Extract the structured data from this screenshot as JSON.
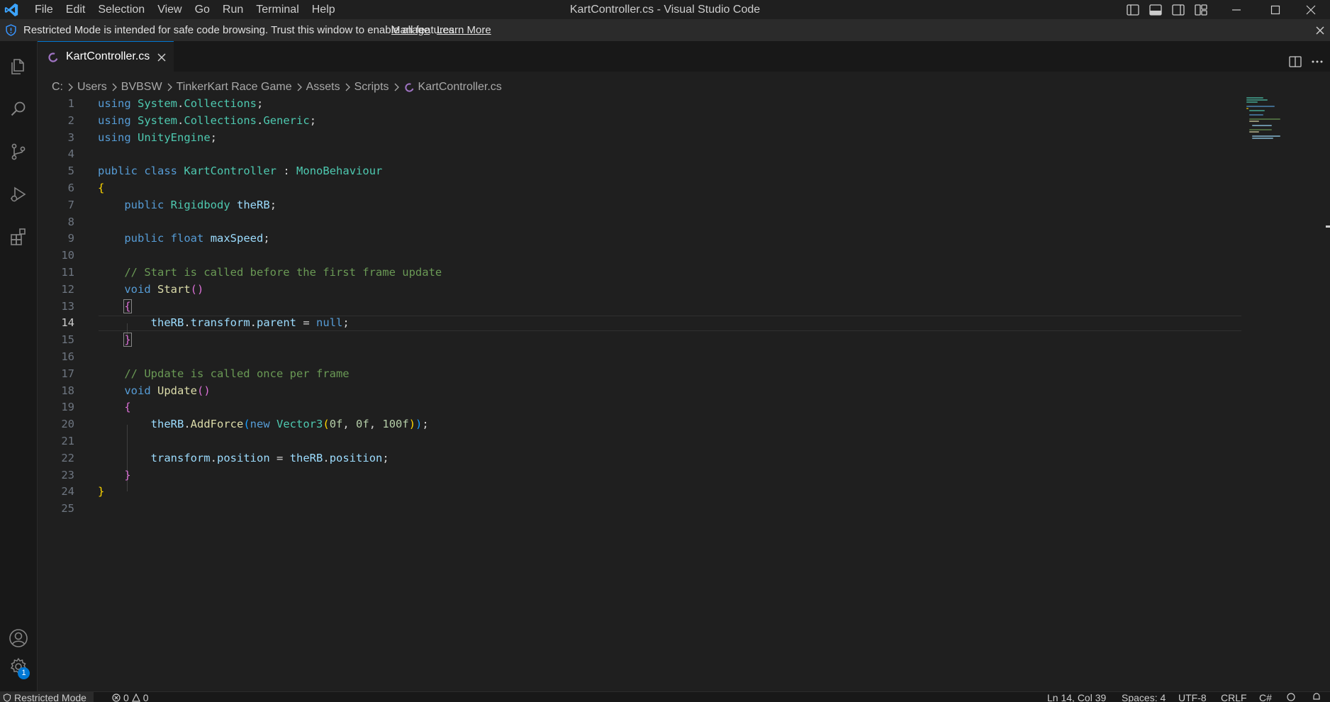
{
  "app": {
    "window_title": "KartController.cs - Visual Studio Code",
    "menu": [
      "File",
      "Edit",
      "Selection",
      "View",
      "Go",
      "Run",
      "Terminal",
      "Help"
    ]
  },
  "banner": {
    "text": "Restricted Mode is intended for safe code browsing. Trust this window to enable all features.",
    "manage_link": "Manage",
    "learn_more_link": "Learn More"
  },
  "activity_bar": {
    "icons": [
      "explorer-icon",
      "search-icon",
      "source-control-icon",
      "run-debug-icon",
      "extensions-icon",
      "accounts-icon",
      "manage-gear-icon"
    ],
    "settings_badge": "1"
  },
  "tab": {
    "label": "KartController.cs",
    "icon": "csharp-file-icon"
  },
  "breadcrumbs": [
    "C:",
    "Users",
    "BVBSW",
    "TinkerKart Race Game",
    "Assets",
    "Scripts",
    "KartController.cs"
  ],
  "editor": {
    "active_line": 14,
    "line_numbers": [
      "1",
      "2",
      "3",
      "4",
      "5",
      "6",
      "7",
      "8",
      "9",
      "10",
      "11",
      "12",
      "13",
      "14",
      "15",
      "16",
      "17",
      "18",
      "19",
      "20",
      "21",
      "22",
      "23",
      "24",
      "25"
    ],
    "code": {
      "l1": {
        "kw": "using",
        "ns1": "System",
        "dot": ".",
        "ns2": "Collections",
        "semi": ";"
      },
      "l2": {
        "kw": "using",
        "ns1": "System",
        "ns2": "Collections",
        "ns3": "Generic"
      },
      "l3": {
        "kw": "using",
        "ns1": "UnityEngine"
      },
      "l5": {
        "kw1": "public",
        "kw2": "class",
        "name": "KartController",
        "colon": ":",
        "base": "MonoBehaviour"
      },
      "l7": {
        "kw": "public",
        "type": "Rigidbody",
        "field": "theRB"
      },
      "l9": {
        "kw1": "public",
        "kw2": "float",
        "field": "maxSpeed"
      },
      "l11": "// Start is called before the first frame update",
      "l12": {
        "kw": "void",
        "fn": "Start",
        "paren": "()"
      },
      "l14": {
        "obj": "theRB",
        "p1": "transform",
        "p2": "parent",
        "eq": "=",
        "null": "null"
      },
      "l17": "// Update is called once per frame",
      "l18": {
        "kw": "void",
        "fn": "Update",
        "paren": "()"
      },
      "l20": {
        "obj": "theRB",
        "fn": "AddForce",
        "kw": "new",
        "type": "Vector3",
        "a1": "0f",
        "a2": "0f",
        "a3": "100f"
      },
      "l22": {
        "obj": "transform",
        "p1": "position",
        "eq": "=",
        "obj2": "theRB",
        "p2": "position"
      },
      "open_brace": "{",
      "close_brace": "}"
    }
  },
  "status_bar": {
    "restricted_mode": "Restricted Mode",
    "errors": "0",
    "warnings": "0",
    "cursor_position": "Ln 14, Col 39",
    "indentation": "Spaces: 4",
    "encoding": "UTF-8",
    "eol": "CRLF",
    "language": "C#"
  },
  "colors": {
    "accent": "#0078d4",
    "keyword": "#569cd6",
    "type": "#4ec9b0",
    "variable": "#9cdcfe",
    "function": "#dcdcaa",
    "comment": "#6a9955",
    "number": "#b5cea8"
  }
}
